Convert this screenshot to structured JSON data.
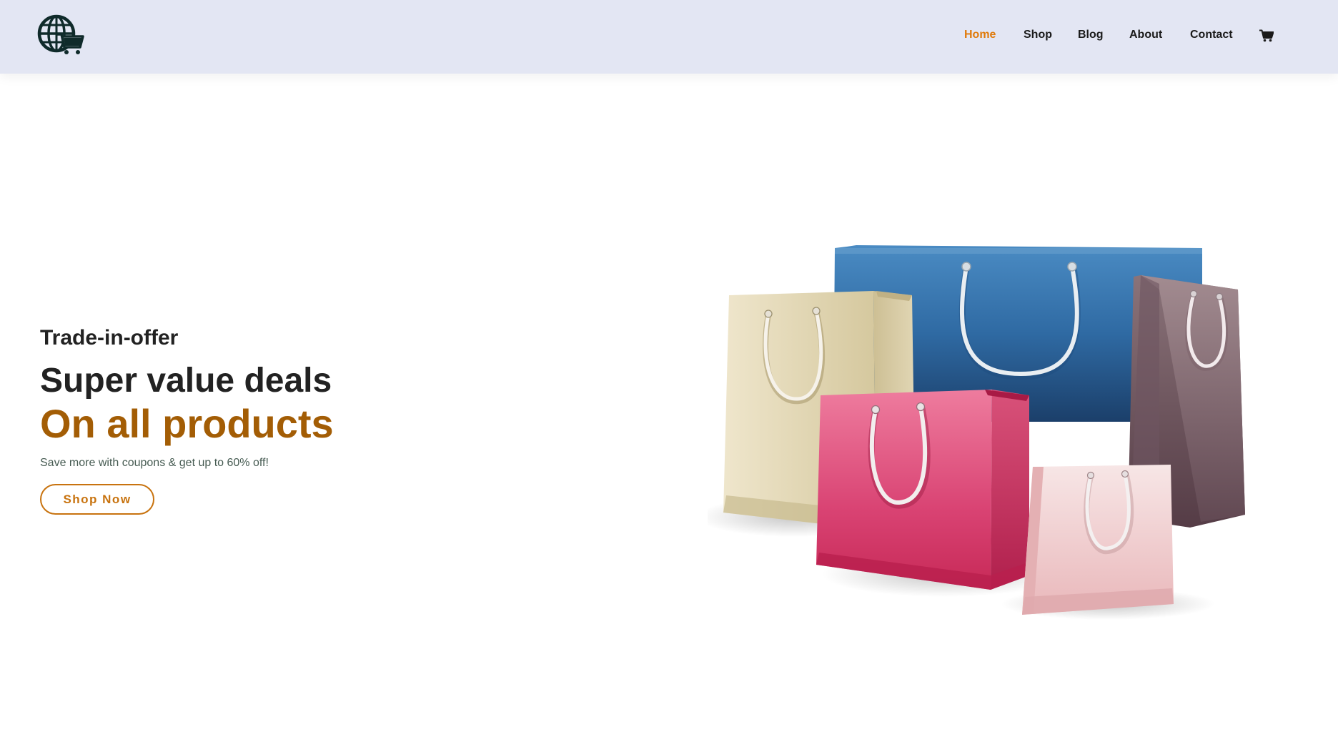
{
  "header": {
    "logo_icon": "globe-cart-icon",
    "nav": [
      {
        "label": "Home",
        "active": true
      },
      {
        "label": "Shop",
        "active": false
      },
      {
        "label": "Blog",
        "active": false
      },
      {
        "label": "About",
        "active": false
      },
      {
        "label": "Contact",
        "active": false
      }
    ],
    "cart_icon": "shopping-cart-icon"
  },
  "hero": {
    "eyebrow": "Trade-in-offer",
    "title_line1": "Super value deals",
    "title_line2": "On all products",
    "subtitle": "Save more with coupons & get up to 60% off!",
    "cta_label": "Shop Now",
    "image": "shopping-bags-illustration"
  },
  "colors": {
    "header_bg": "#e3e6f3",
    "accent": "#e07a0a",
    "title_accent": "#a35d05",
    "text_dark": "#222222"
  }
}
